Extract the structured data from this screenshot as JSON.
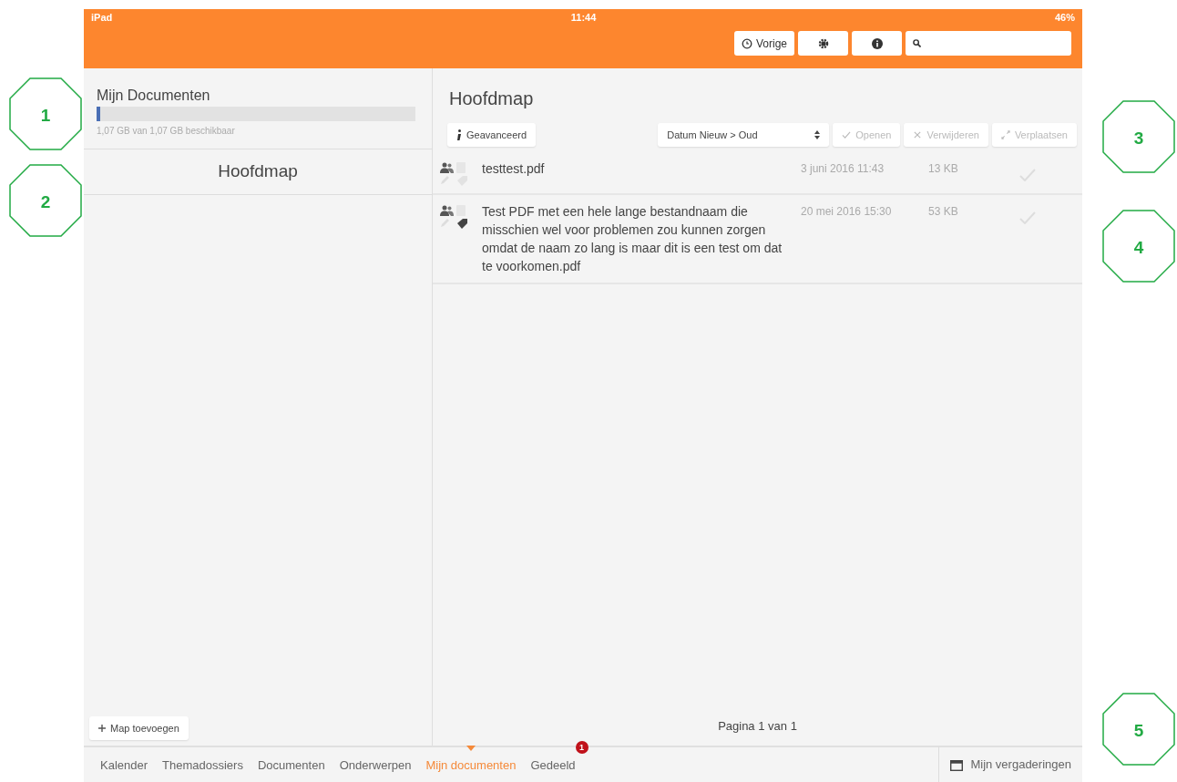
{
  "callouts": [
    "1",
    "2",
    "3",
    "4",
    "5"
  ],
  "status_bar": {
    "carrier": "iPad",
    "time": "11:44",
    "battery": "46%"
  },
  "toolbar": {
    "back_button": "Vorige"
  },
  "sidebar": {
    "title": "Mijn Documenten",
    "storage": {
      "level": 0.01,
      "text": "1,07 GB van 1,07 GB beschikbaar"
    },
    "current_folder": "Hoofdmap",
    "add_button": "Map toevoegen"
  },
  "main": {
    "title": "Hoofdmap",
    "advanced_button": "Geavanceerd",
    "sort": "Datum Nieuw > Oud",
    "actions": [
      {
        "label": "Openen",
        "disabled": true
      },
      {
        "label": "Verwijderen",
        "disabled": true
      },
      {
        "label": "Verplaatsen",
        "disabled": true
      }
    ],
    "files": [
      {
        "name": "testtest.pdf",
        "date": "3 juni 2016 11:43",
        "size": "13 KB",
        "tagged": false,
        "selected": false
      },
      {
        "name": "Test PDF met een hele lange bestandnaam die misschien wel voor problemen zou kunnen zorgen omdat de naam zo lang is maar dit is een test om dat te voorkomen.pdf",
        "date": "20 mei 2016 15:30",
        "size": "53 KB",
        "tagged": true,
        "selected": false
      }
    ],
    "pagination": "Pagina 1 van 1"
  },
  "bottom_tabs": [
    {
      "label": "Kalender",
      "selected": false
    },
    {
      "label": "Themadossiers",
      "selected": false
    },
    {
      "label": "Documenten",
      "selected": false
    },
    {
      "label": "Onderwerpen",
      "selected": false
    },
    {
      "label": "Mijn documenten",
      "selected": true
    },
    {
      "label": "Gedeeld",
      "selected": false,
      "badge": "1"
    }
  ],
  "meetings_button": "Mijn vergaderingen"
}
